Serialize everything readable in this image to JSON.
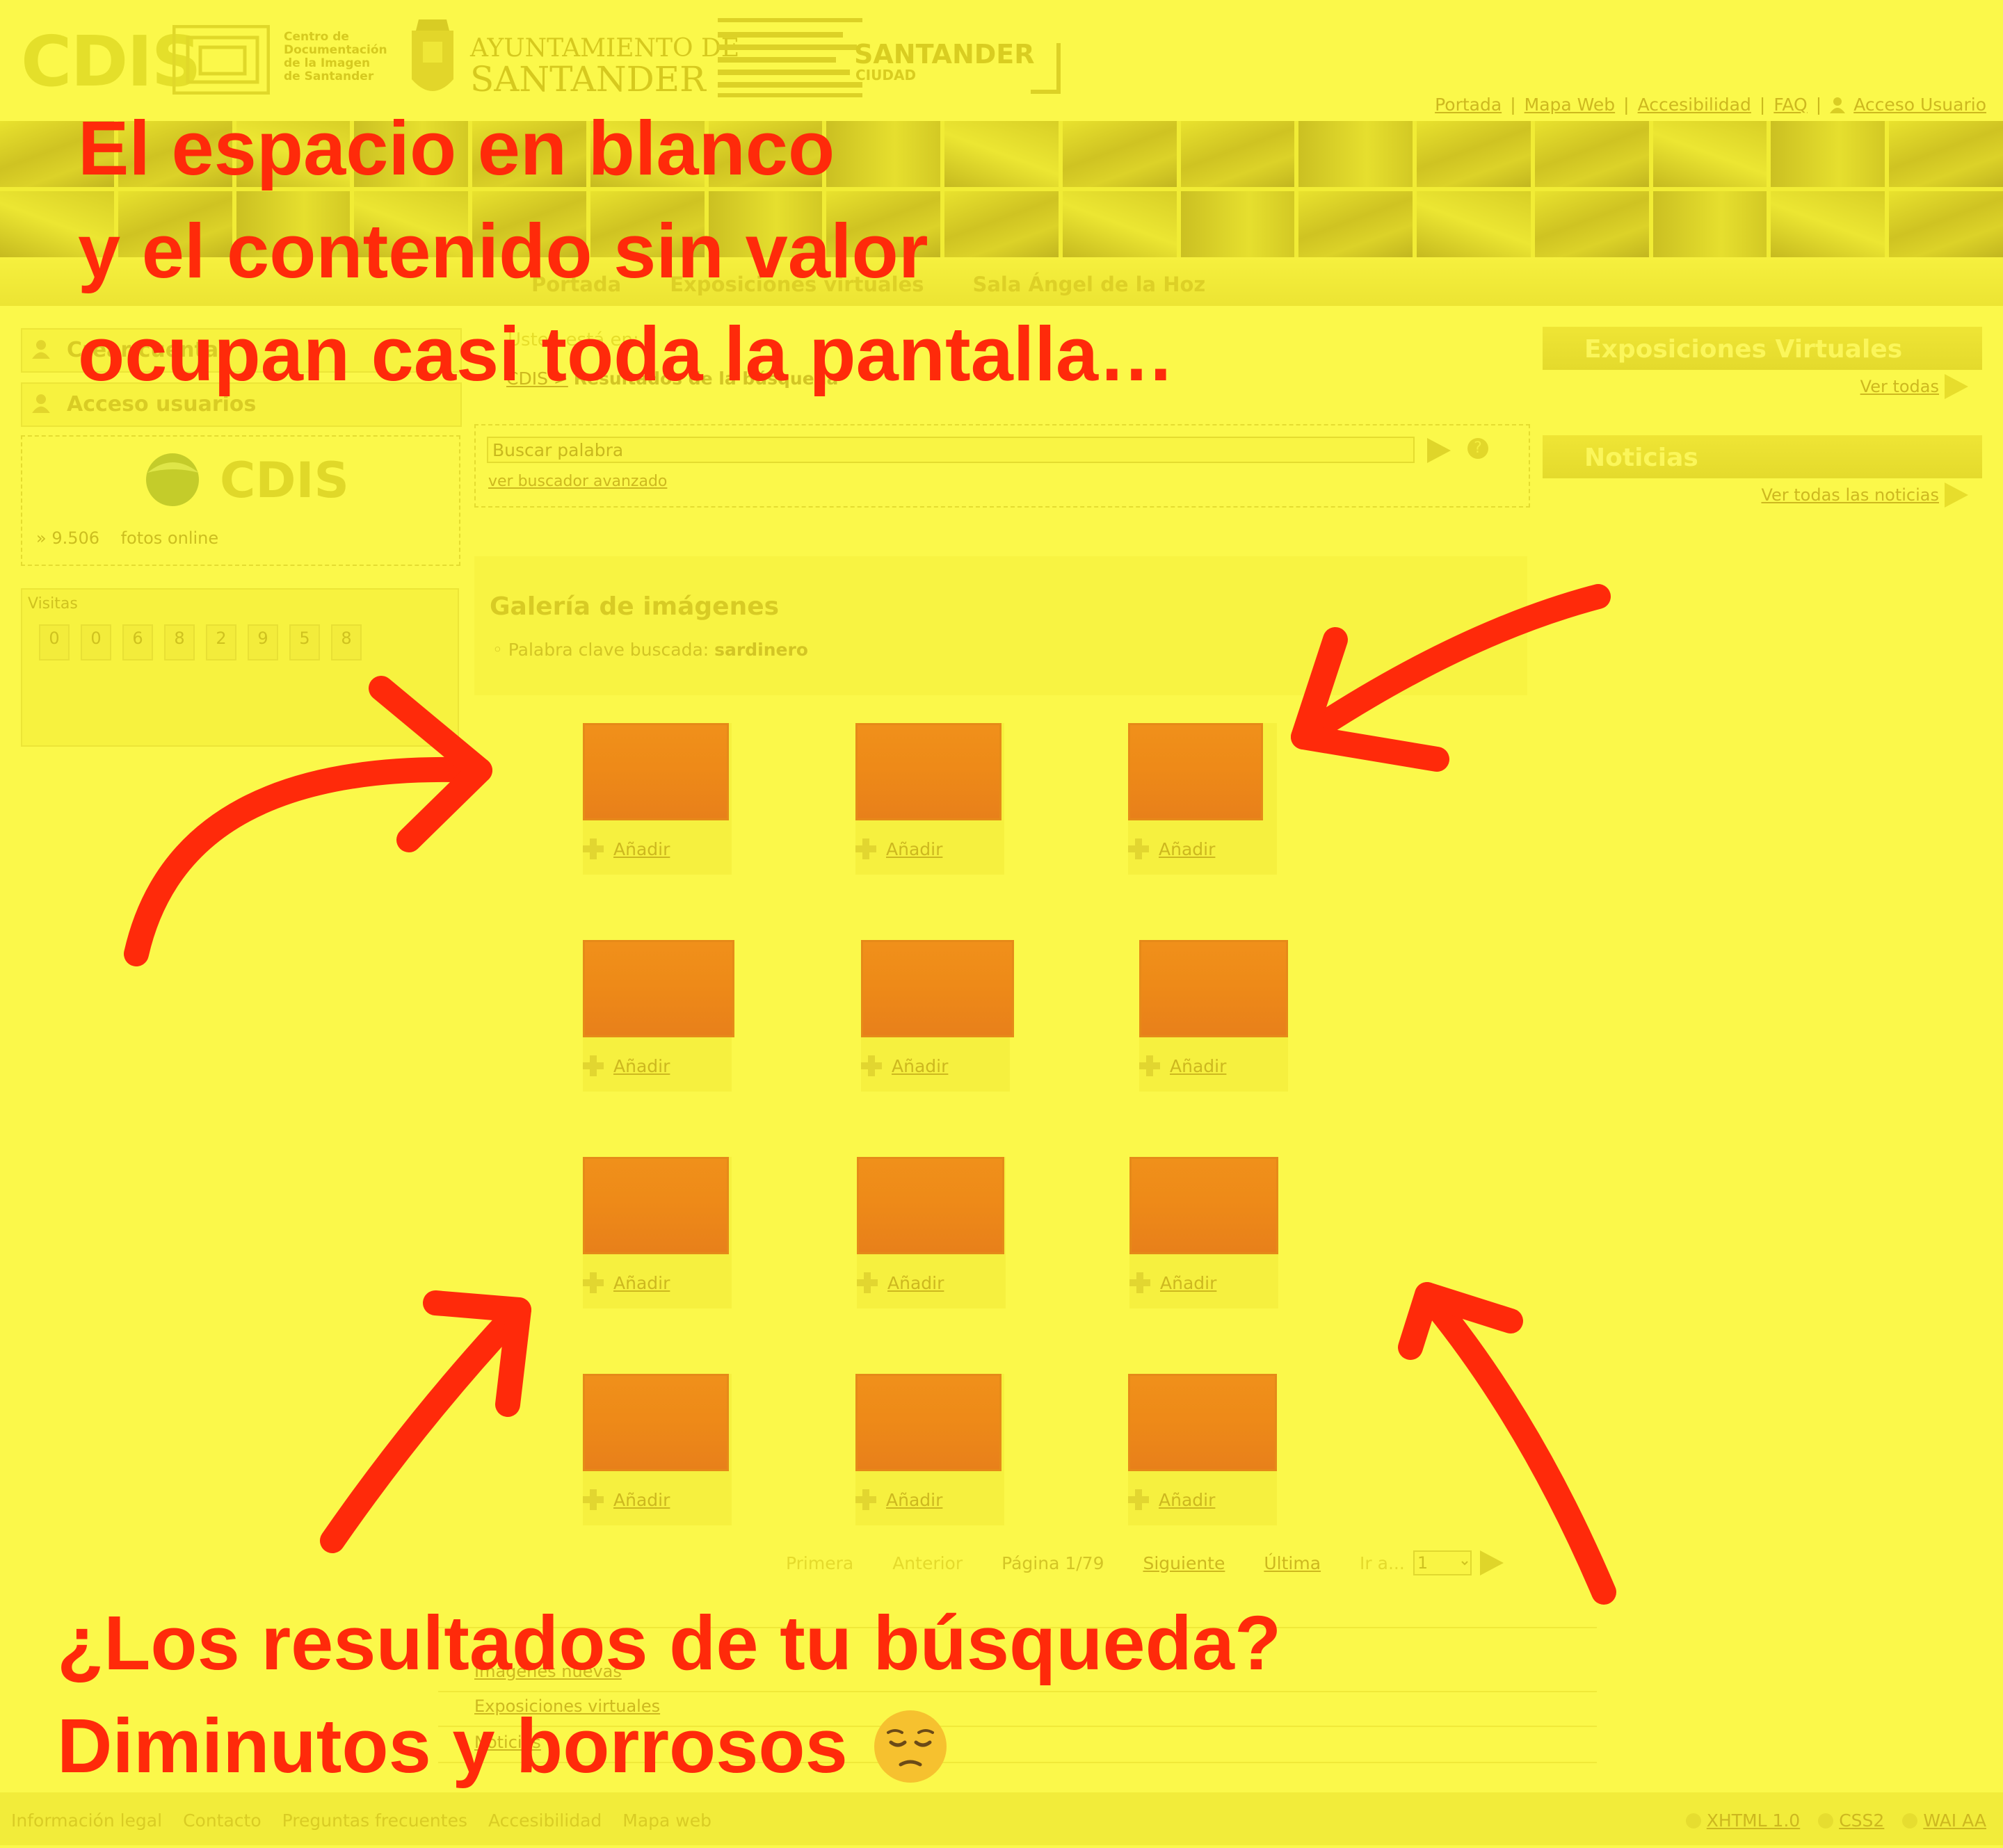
{
  "header": {
    "cdis_logo": "CDIS",
    "cdis_subtitle": [
      "Centro de",
      "Documentación",
      "de la Imagen",
      "de Santander"
    ],
    "ayuntamiento_line1": "AYUNTAMIENTO DE",
    "ayuntamiento_line2": "SANTANDER",
    "santander_logo": "SANTANDER",
    "santander_sub": "CIUDAD",
    "top_links": [
      "Portada",
      "Mapa Web",
      "Accesibilidad",
      "FAQ",
      "Acceso Usuario"
    ]
  },
  "main_nav": [
    "Portada",
    "Exposiciones virtuales",
    "Sala Ángel de la Hoz"
  ],
  "left": {
    "box1_label": "Crear cuenta",
    "box2_label": "Acceso usuarios",
    "cdis_word": "CDIS",
    "fotos_count": "9.506",
    "fotos_label": "fotos online",
    "visits_title": "Visitas",
    "visit_digits": [
      "0",
      "0",
      "6",
      "8",
      "2",
      "9",
      "5",
      "8"
    ]
  },
  "center": {
    "ghost_text": "Usted está en:",
    "breadcrumb_root": "CDIS >",
    "breadcrumb_current": "Resultados de la búsqueda",
    "search_placeholder": "Buscar palabra",
    "search_help": "?",
    "advanced_link": "ver buscador avanzado",
    "gallery_title": "Galería de imágenes",
    "keyword_label": "Palabra clave buscada:",
    "keyword_value": "sardinero",
    "add_label": "Añadir",
    "pager": {
      "first": "Primera",
      "prev": "Anterior",
      "page": "Página 1/79",
      "next": "Siguiente",
      "last": "Última",
      "goto": "Ir a...",
      "goto_value": "1"
    }
  },
  "right": {
    "exhibitions_title": "Exposiciones Virtuales",
    "exhibitions_link": "Ver todas",
    "news_title": "Noticias",
    "news_link": "Ver todas las noticias"
  },
  "bottom_links": [
    "Imágenes nuevas",
    "Exposiciones virtuales",
    "Noticias"
  ],
  "footer": {
    "links": [
      "Información legal",
      "Contacto",
      "Preguntas frecuentes",
      "Accesibilidad",
      "Mapa web"
    ],
    "badges": [
      "XHTML 1.0",
      "CSS2",
      "WAI AA"
    ]
  },
  "annotation": {
    "headline": [
      "El espacio en blanco",
      "y el contenido sin valor",
      "ocupan casi toda la pantalla…"
    ],
    "bottom": [
      "¿Los resultados de tu búsqueda?",
      "Diminutos y borrosos"
    ],
    "emoji": "pensive-face",
    "text_color": "#ff2a0a",
    "overlay_color": "#fbf84a"
  }
}
